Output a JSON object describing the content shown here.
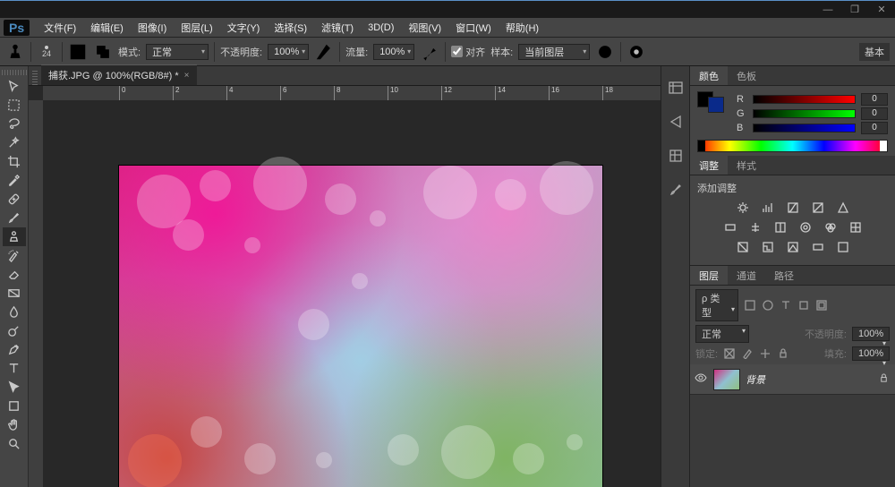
{
  "window": {
    "minimize": "—",
    "restore": "❐",
    "close": "✕"
  },
  "app": {
    "logo": "Ps"
  },
  "menu": {
    "items": [
      "文件(F)",
      "编辑(E)",
      "图像(I)",
      "图层(L)",
      "文字(Y)",
      "选择(S)",
      "滤镜(T)",
      "3D(D)",
      "视图(V)",
      "窗口(W)",
      "帮助(H)"
    ]
  },
  "options": {
    "brush_size": "24",
    "mode_label": "模式:",
    "mode_value": "正常",
    "opacity_label": "不透明度:",
    "opacity_value": "100%",
    "flow_label": "流量:",
    "flow_value": "100%",
    "aligned_label": "对齐",
    "aligned_checked": true,
    "sample_label": "样本:",
    "sample_value": "当前图层",
    "essentials": "基本"
  },
  "document": {
    "tab_title": "捕获.JPG @ 100%(RGB/8#) *"
  },
  "ruler": {
    "ticks": [
      "0",
      "2",
      "4",
      "6",
      "8",
      "10",
      "12",
      "14",
      "16",
      "18"
    ]
  },
  "panels": {
    "color": {
      "tab_color": "颜色",
      "tab_swatches": "色板",
      "fg": "#000000",
      "bg": "#0a2a8a",
      "r_label": "R",
      "g_label": "G",
      "b_label": "B",
      "r_value": "0",
      "g_value": "0",
      "b_value": "0"
    },
    "adjust": {
      "tab_adjust": "调整",
      "tab_styles": "样式",
      "hint": "添加调整"
    },
    "layers": {
      "tab_layers": "图层",
      "tab_channels": "通道",
      "tab_paths": "路径",
      "kind_label": "ρ 类型",
      "blend_value": "正常",
      "opacity_label": "不透明度:",
      "opacity_value": "100%",
      "lock_label": "锁定:",
      "fill_label": "填充:",
      "fill_value": "100%",
      "layer_name": "背景",
      "eye": "👁"
    }
  }
}
